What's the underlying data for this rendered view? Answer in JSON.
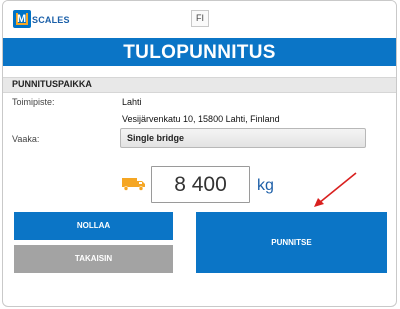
{
  "header": {
    "logo_letter": "M",
    "logo_text": "SCALES",
    "language": "FI"
  },
  "title": "TULOPUNNITUS",
  "section": {
    "title": "PUNNITUSPAIKKA",
    "site_label": "Toimipiste:",
    "site_name": "Lahti",
    "site_address": "Vesijärvenkatu 10, 15800 Lahti, Finland",
    "scale_label": "Vaaka:",
    "scale_value": "Single bridge"
  },
  "weight": {
    "value": "8 400",
    "unit": "kg"
  },
  "buttons": {
    "reset": "NOLLAA",
    "back": "TAKAISIN",
    "weigh": "PUNNITSE"
  },
  "colors": {
    "primary": "#0b75c6",
    "secondary_button": "#a3a3a3",
    "truck": "#f5a623",
    "arrow": "#d9201f"
  },
  "icons": {
    "truck": "truck-icon",
    "annotation": "red-arrow-icon"
  }
}
